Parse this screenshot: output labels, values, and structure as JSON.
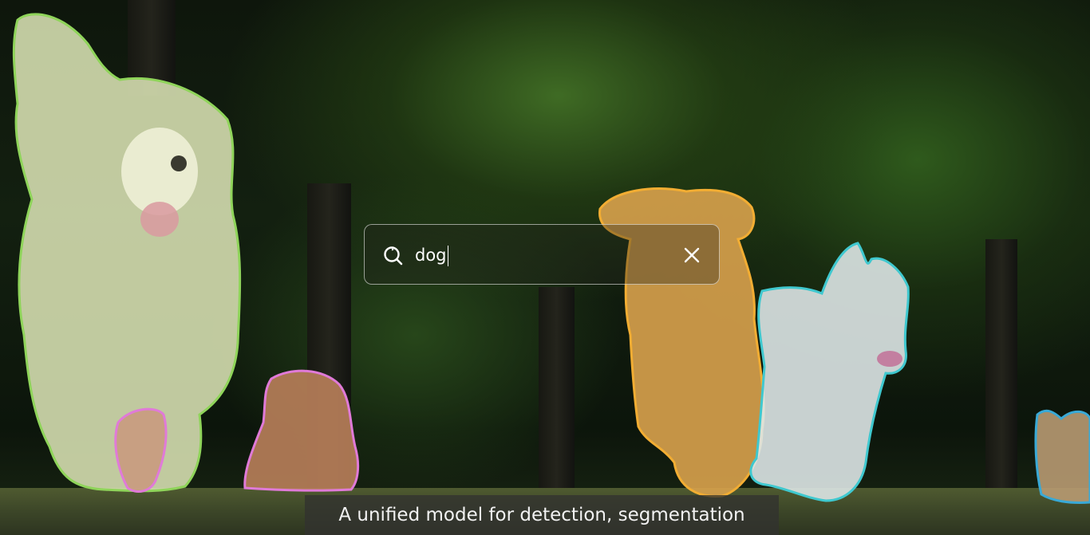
{
  "search": {
    "query": "dog",
    "icon": "search-refresh-icon",
    "clear_icon": "close-icon"
  },
  "caption": {
    "text": "A unified model for detection, segmentation"
  },
  "segmentation": {
    "outline_colors": [
      "#8fd45a",
      "#e07ad8",
      "#f2ad33",
      "#3fc8cf",
      "#39a9d6",
      "#c69be0"
    ]
  }
}
